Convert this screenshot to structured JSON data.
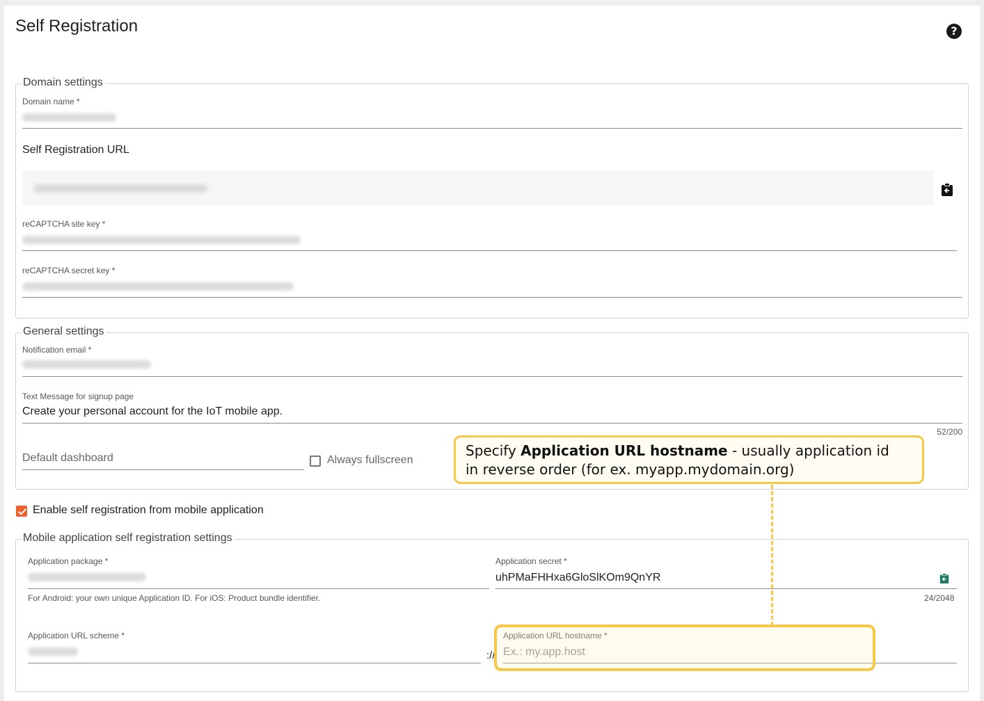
{
  "page": {
    "title": "Self Registration"
  },
  "domain_settings": {
    "legend": "Domain settings",
    "domain_name_label": "Domain name *",
    "self_registration_url_label": "Self Registration URL",
    "recaptcha_site_key_label": "reCAPTCHA site key *",
    "recaptcha_secret_key_label": "reCAPTCHA secret key *"
  },
  "general_settings": {
    "legend": "General settings",
    "notification_email_label": "Notification email *",
    "text_message_label": "Text Message for signup page",
    "text_message_value": "Create your personal account for the IoT mobile app.",
    "text_message_counter": "52/200",
    "default_dashboard_placeholder": "Default dashboard",
    "always_fullscreen_label": "Always fullscreen"
  },
  "mobile": {
    "enable_label": "Enable self registration from mobile application",
    "legend": "Mobile application self registration settings",
    "app_package_label": "Application package *",
    "app_package_hint": "For Android: your own unique Application ID. For iOS: Product bundle identifier.",
    "app_secret_label": "Application secret *",
    "app_secret_value": "uhPMaFHHxa6GloSlKOm9QnYR",
    "app_secret_counter": "24/2048",
    "url_scheme_label": "Application URL scheme *",
    "scheme_separator": "://",
    "url_hostname_label": "Application URL hostname *",
    "url_hostname_placeholder": "Ex.: my.app.host"
  },
  "callout": {
    "prefix": "Specify ",
    "bold": "Application URL hostname",
    "line1_suffix": " - usually application id",
    "line2": "in reverse order (for ex. myapp.mydomain.org)"
  },
  "colors": {
    "accent": "#f2612c",
    "callout_border": "#f7c748",
    "copy_icon_green": "#1e7b63"
  },
  "icons": {
    "help": "help-icon",
    "copy_url": "clipboard-icon",
    "copy_secret": "clipboard-icon"
  }
}
